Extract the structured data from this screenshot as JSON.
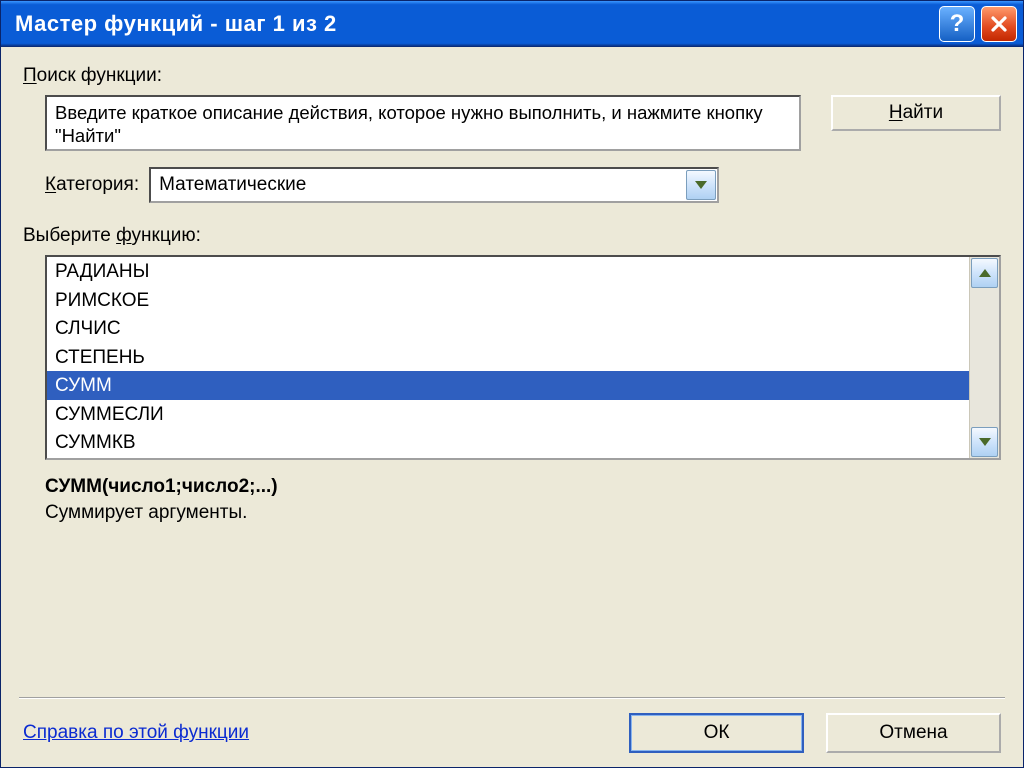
{
  "titlebar": {
    "title": "Мастер функций - шаг 1 из 2"
  },
  "search": {
    "label_prefix": "П",
    "label_rest": "оиск функции:",
    "text": "Введите краткое описание действия, которое нужно выполнить, и нажмите кнопку \"Найти\"",
    "find_button_prefix": "Н",
    "find_button_rest": "айти"
  },
  "category": {
    "label_prefix": "К",
    "label_rest": "атегория:",
    "selected": "Математические"
  },
  "function_select": {
    "label_prefix": "ф",
    "label_before": "Выберите ",
    "label_rest": "ункцию:"
  },
  "functions": {
    "items": [
      "РАДИАНЫ",
      "РИМСКОЕ",
      "СЛЧИС",
      "СТЕПЕНЬ",
      "СУММ",
      "СУММЕСЛИ",
      "СУММКВ"
    ],
    "selected_index": 4
  },
  "details": {
    "syntax": "СУММ(число1;число2;...)",
    "description": "Суммирует аргументы."
  },
  "footer": {
    "help_link": "Справка по этой функции",
    "ok": "ОК",
    "cancel": "Отмена"
  }
}
